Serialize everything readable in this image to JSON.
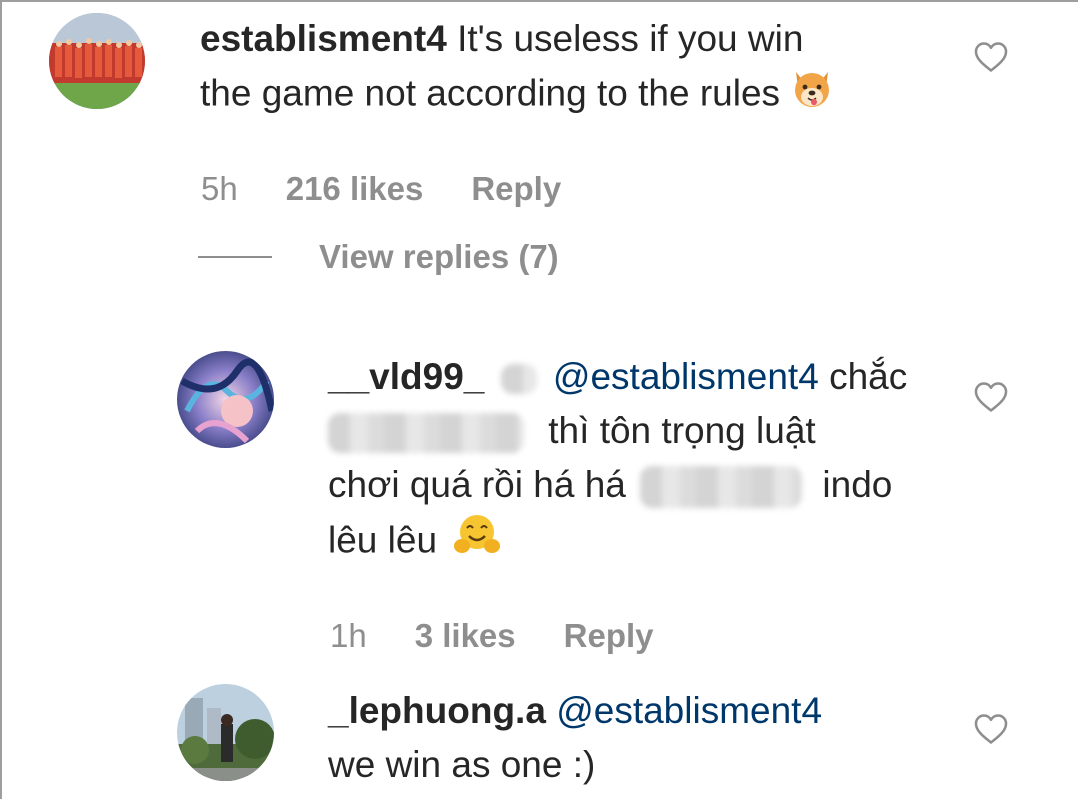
{
  "comments": [
    {
      "username": "establisment4",
      "text_line1": "It's useless if you win",
      "text_line2": "the game not according to the rules",
      "emoji": "dog-face-emoji",
      "time": "5h",
      "likes": "216 likes",
      "reply": "Reply",
      "view_replies": "View replies (7)"
    },
    {
      "username": "__vld99_",
      "mention": "@establisment4",
      "text_a": "chắc",
      "text_b": "thì tôn trọng luật",
      "text_c": "chơi quá rồi há há",
      "text_d": "indo",
      "text_e": "lêu lêu",
      "emoji": "hugging-face-emoji",
      "time": "1h",
      "likes": "3 likes",
      "reply": "Reply"
    },
    {
      "username": "_lephuong.a",
      "mention": "@establisment4",
      "text_line2": "we win as one :)"
    }
  ],
  "colors": {
    "text": "#262626",
    "meta": "#8e8e8e",
    "mention": "#00376b",
    "heart": "#8e8e8e"
  },
  "icons": {
    "like": "heart-outline-icon"
  }
}
